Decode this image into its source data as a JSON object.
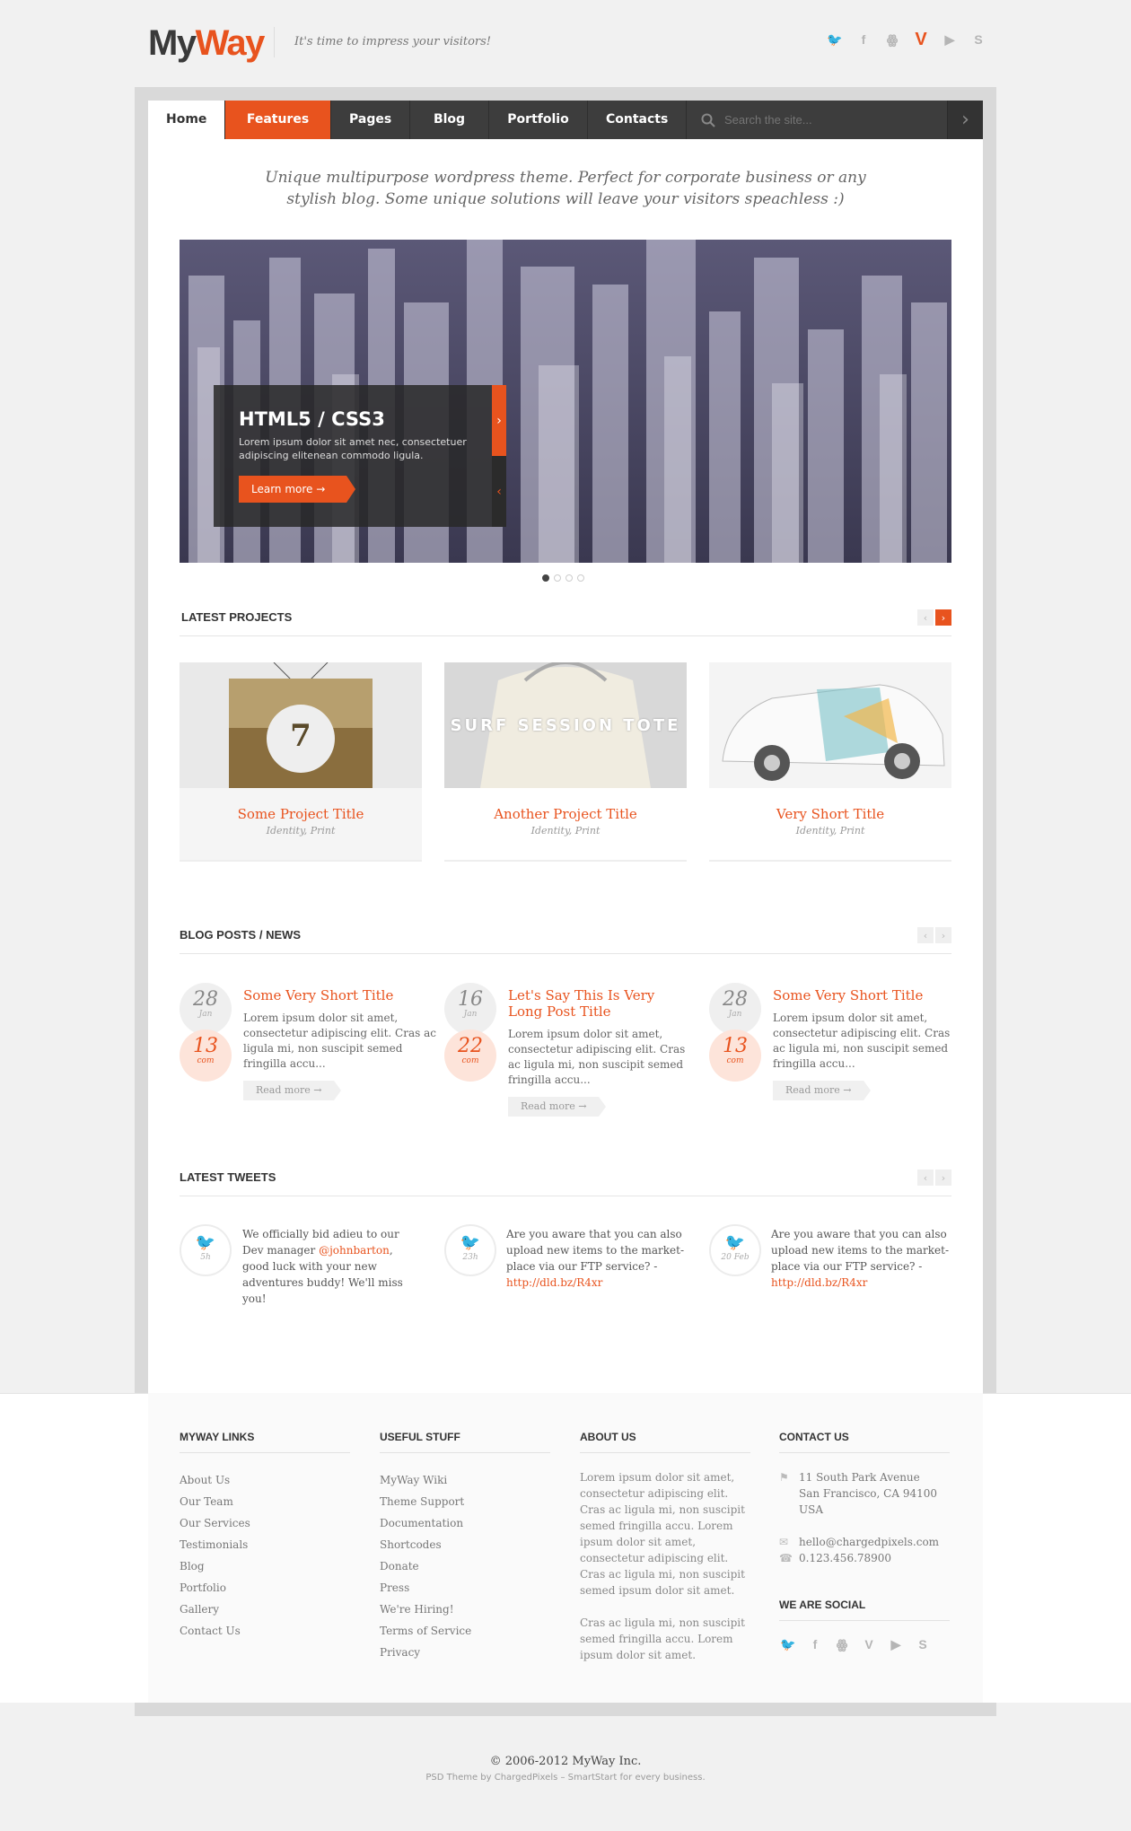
{
  "header": {
    "logo_part1": "My",
    "logo_part2": "Way",
    "tagline": "It's time to impress your visitors!",
    "social": [
      {
        "name": "twitter-icon",
        "glyph": "🐦"
      },
      {
        "name": "facebook-icon",
        "glyph": "f"
      },
      {
        "name": "flickr-icon",
        "glyph": "ꙮ"
      },
      {
        "name": "vimeo-icon",
        "glyph": "V"
      },
      {
        "name": "youtube-icon",
        "glyph": "▶"
      },
      {
        "name": "skype-icon",
        "glyph": "S"
      }
    ]
  },
  "nav": {
    "items": [
      "Home",
      "Features",
      "Pages",
      "Blog",
      "Portfolio",
      "Contacts"
    ],
    "search_placeholder": "Search the site...",
    "go_glyph": "›"
  },
  "intro": "Unique multipurpose wordpress theme. Perfect for corporate business or any stylish blog. Some unique solutions will leave your visitors speachless :)",
  "slider": {
    "title": "HTML5 / CSS3",
    "text": "Lorem ipsum dolor sit amet nec, consectetuer adipiscing elitenean commodo ligula.",
    "button": "Learn more  →",
    "next": "›",
    "prev": "‹"
  },
  "projects": {
    "title": "LATEST PROJECTS",
    "items": [
      {
        "title": "Some Project Title",
        "cat": "Identity, Print",
        "badge": "7"
      },
      {
        "title": "Another Project Title",
        "cat": "Identity, Print",
        "overlay": "SURF SESSION TOTE"
      },
      {
        "title": "Very Short Title",
        "cat": "Identity, Print"
      }
    ]
  },
  "blog": {
    "title": "BLOG POSTS / NEWS",
    "items": [
      {
        "day": "28",
        "month": "Jan",
        "com": "13",
        "com_label": "com",
        "title": "Some Very Short Title",
        "text": "Lorem ipsum dolor sit amet, consectetur adipiscing elit. Cras ac ligula mi, non suscipit semed fringilla accu...",
        "more": "Read more  →"
      },
      {
        "day": "16",
        "month": "Jan",
        "com": "22",
        "com_label": "com",
        "title": "Let's Say This Is Very Long Post Title",
        "text": "Lorem ipsum dolor sit amet, consectetur adipiscing elit. Cras ac ligula mi, non suscipit semed fringilla accu...",
        "more": "Read more  →"
      },
      {
        "day": "28",
        "month": "Jan",
        "com": "13",
        "com_label": "com",
        "title": "Some Very Short Title",
        "text": "Lorem ipsum dolor sit amet, consectetur adipiscing elit. Cras ac ligula mi, non suscipit semed fringilla accu...",
        "more": "Read more  →"
      }
    ]
  },
  "tweets": {
    "title": "LATEST TWEETS",
    "items": [
      {
        "time": "5h",
        "pre": "We officially bid adieu to our Dev manager ",
        "handle": "@johnbarton",
        "post": ", good luck with your new adventures buddy! We'll miss you!"
      },
      {
        "time": "23h",
        "pre": "Are you aware that you can also upload new items to the market-place via our FTP service? - ",
        "handle": "http://dld.bz/R4xr",
        "post": ""
      },
      {
        "time": "20 Feb",
        "pre": "Are you aware that you can also upload new items to the market-place via our FTP service? - ",
        "handle": "http://dld.bz/R4xr",
        "post": ""
      }
    ]
  },
  "footer": {
    "links_title": "MYWAY LINKS",
    "links": [
      "About Us",
      "Our Team",
      "Our Services",
      "Testimonials",
      "Blog",
      "Portfolio",
      "Gallery",
      "Contact Us"
    ],
    "useful_title": "USEFUL STUFF",
    "useful": [
      "MyWay Wiki",
      "Theme Support",
      "Documentation",
      "Shortcodes",
      "Donate",
      "Press",
      "We're Hiring!",
      "Terms of Service",
      "Privacy"
    ],
    "about_title": "ABOUT US",
    "about1": "Lorem ipsum dolor sit amet, consectetur adipiscing elit. Cras ac ligula mi, non suscipit semed fringilla accu. Lorem ipsum dolor sit amet, consectetur adipiscing elit. Cras ac ligula mi, non suscipit semed ipsum dolor sit amet.",
    "about2": "Cras ac ligula mi, non suscipit semed fringilla accu. Lorem ipsum dolor sit amet.",
    "contact_title": "CONTACT US",
    "address": [
      "11 South Park Avenue",
      "San Francisco, CA 94100",
      "USA"
    ],
    "email": "hello@chargedpixels.com",
    "phone": "0.123.456.78900",
    "social_title": "WE ARE SOCIAL"
  },
  "bottom": {
    "copyright": "© 2006-2012 MyWay Inc.",
    "credits": "PSD Theme by ChargedPixels – SmartStart for every business."
  },
  "colors": {
    "accent": "#e8531e",
    "dark_nav": "#3d3d3d"
  }
}
